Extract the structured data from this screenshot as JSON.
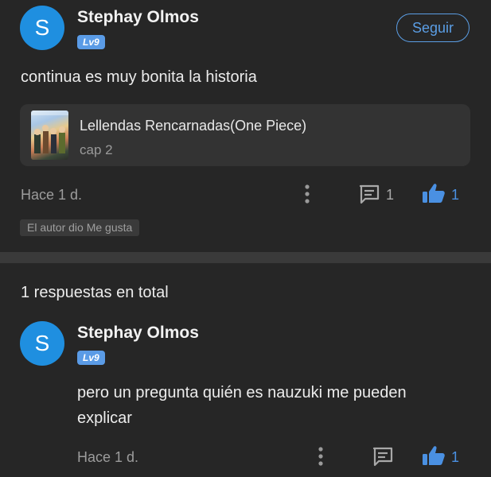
{
  "post": {
    "avatar_letter": "S",
    "username": "Stephay Olmos",
    "level": "Lv9",
    "follow_label": "Seguir",
    "comment": "continua es muy bonita la historia",
    "book": {
      "title": "Lellendas Rencarnadas(One Piece)",
      "chapter": "cap 2"
    },
    "timestamp": "Hace 1 d.",
    "reply_count": "1",
    "like_count": "1",
    "author_liked": "El autor dio Me gusta"
  },
  "replies": {
    "total_label": "1 respuestas en total",
    "items": [
      {
        "avatar_letter": "S",
        "username": "Stephay Olmos",
        "level": "Lv9",
        "text": "pero un pregunta quién es nauzuki me pueden explicar",
        "timestamp": "Hace 1 d.",
        "like_count": "1"
      }
    ]
  },
  "icons": {
    "more": "more-vertical-icon",
    "comment": "comment-icon",
    "like": "thumbs-up-icon"
  },
  "colors": {
    "background": "#262626",
    "accent_blue": "#4a90e2",
    "avatar_blue": "#1f8fe0",
    "level_badge": "#5a9be6"
  }
}
